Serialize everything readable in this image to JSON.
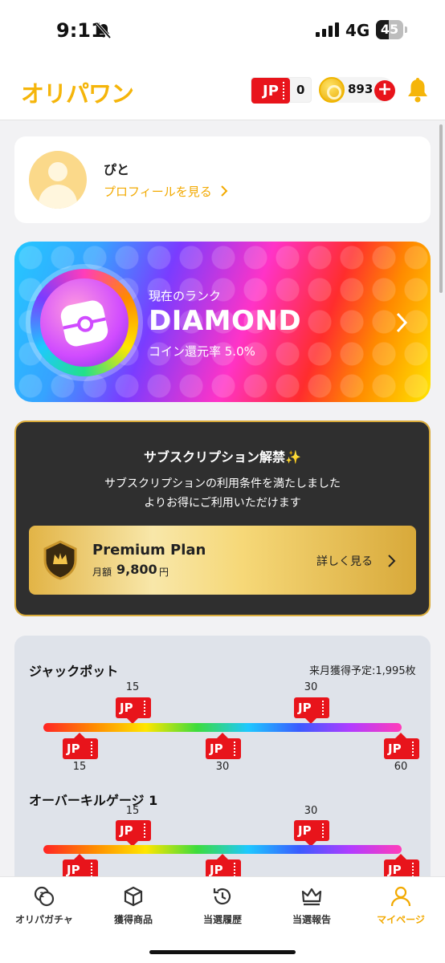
{
  "status_bar": {
    "time": "9:11",
    "network": "4G",
    "battery": "45"
  },
  "header": {
    "logo": "オリパワン",
    "jp_label": "JP",
    "jp_count": "0",
    "coin_count": "893",
    "add_coin_icon": "plus-icon",
    "notification_icon": "bell-icon"
  },
  "profile": {
    "name": "ぴと",
    "link": "プロフィールを見る"
  },
  "rank": {
    "label": "現在のランク",
    "name": "DIAMOND",
    "rate": "コイン還元率 5.0%",
    "rate_value": 5.0
  },
  "subscription": {
    "title": "サブスクリプション解禁✨",
    "line1": "サブスクリプションの利用条件を満たしました",
    "line2": "よりお得にご利用いただけます",
    "plan_name": "Premium Plan",
    "price_label": "月額",
    "price": "9,800",
    "price_unit": "円",
    "detail": "詳しく見る"
  },
  "jackpot": {
    "title": "ジャックポット",
    "next_month": "来月獲得予定:1,995枚",
    "top_values": [
      "15",
      "30"
    ],
    "bottom_values": [
      "15",
      "30",
      "60"
    ],
    "ticket_label": "JP"
  },
  "overkill": {
    "title": "オーバーキルゲージ 1",
    "top_values": [
      "15",
      "30"
    ],
    "ticket_label": "JP"
  },
  "tabs": [
    {
      "label": "オリパガチャ",
      "icon": "gacha-coin-icon",
      "active": false
    },
    {
      "label": "獲得商品",
      "icon": "box-icon",
      "active": false
    },
    {
      "label": "当選履歴",
      "icon": "history-icon",
      "active": false
    },
    {
      "label": "当選報告",
      "icon": "crown-icon",
      "active": false
    },
    {
      "label": "マイページ",
      "icon": "user-icon",
      "active": true
    }
  ],
  "colors": {
    "accent": "#f2a900",
    "jp_red": "#e8141b",
    "card_dark": "#2f2f2f"
  }
}
